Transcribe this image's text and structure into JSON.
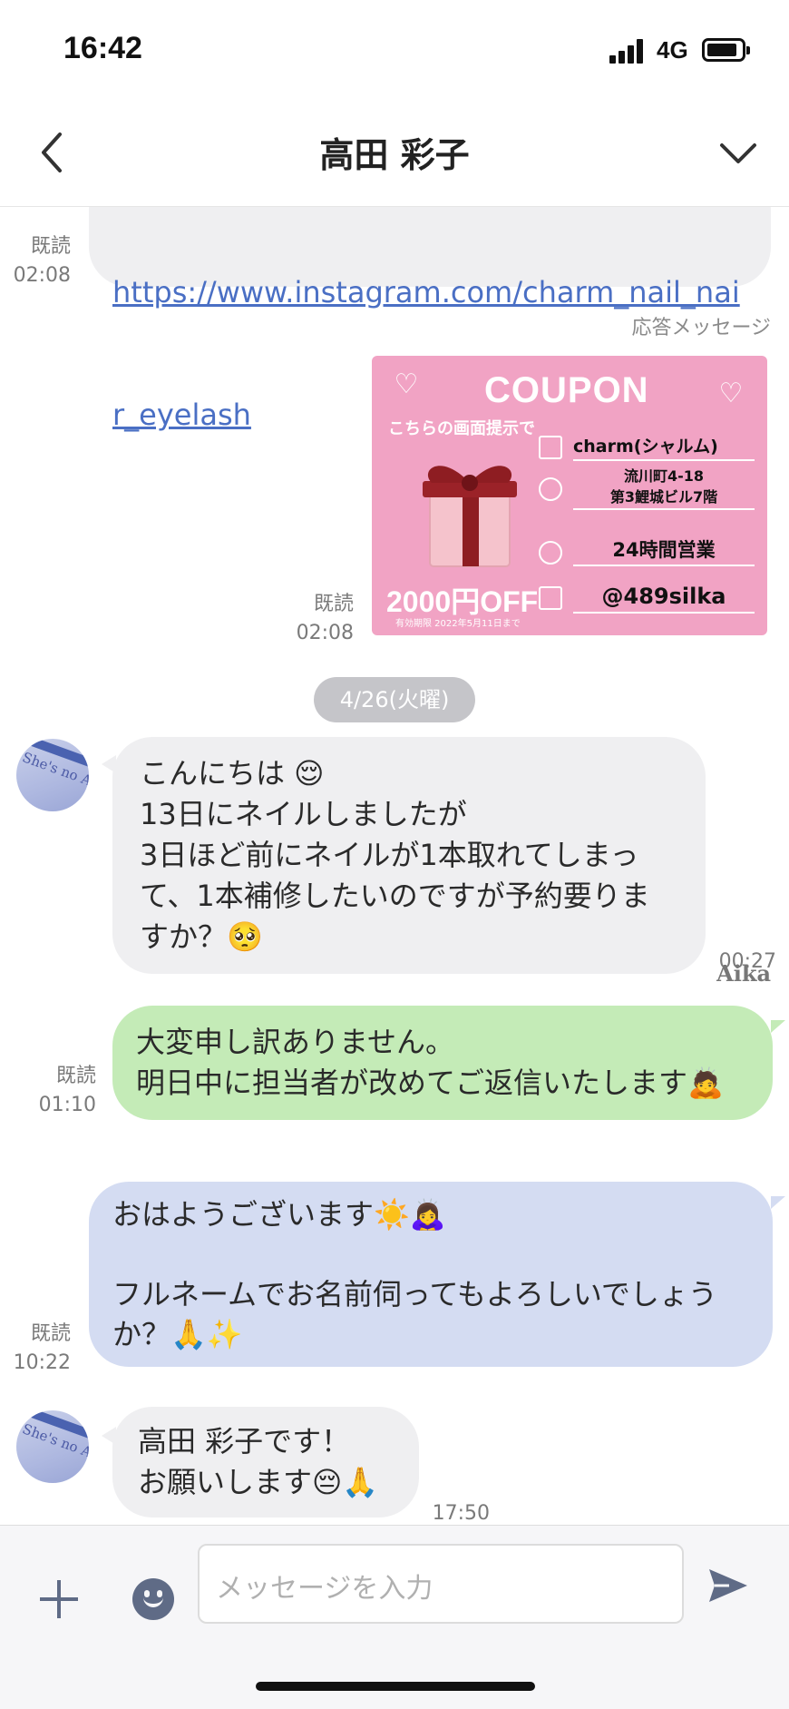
{
  "status_bar": {
    "time": "16:42",
    "network": "4G"
  },
  "header": {
    "title": "高田 彩子"
  },
  "messages": {
    "link_message": {
      "text_line1": "https://www.instagram.com/charm_nail_nai",
      "text_line2": "r_eyelash",
      "read": "既読",
      "time": "02:08"
    },
    "auto_reply_label": "応答メッセージ",
    "coupon_message": {
      "read": "既読",
      "time": "02:08",
      "coupon": {
        "title": "COUPON",
        "subtitle": "こちらの画面提示で",
        "discount": "2000円OFF",
        "valid": "有効期限 2022年5月11日まで",
        "shop": "charm(シャルム)",
        "address_line1": "流川町4-18",
        "address_line2": "第3鯉城ビル7階",
        "hours": "24時間営業",
        "line_id": "@489silka"
      }
    },
    "date_separator": "4/26(火曜)",
    "customer_msg1": {
      "text": "こんにちは 😌\n13日にネイルしましたが\n3日ほど前にネイルが1本取れてしまっ\nて、1本補修したいのですが予約要りま\nすか？🥺",
      "time": "00:27"
    },
    "reply_msg1": {
      "text": "大変申し訳ありません。\n明日中に担当者が改めてご返信いたします🙇",
      "read": "既読",
      "time": "01:10"
    },
    "sender_name": "Aika",
    "reply_msg2": {
      "text": "おはようございます☀️🙇‍♀️\n\nフルネームでお名前伺ってもよろしいでしょう\nか？🙏✨",
      "read": "既読",
      "time": "10:22"
    },
    "customer_msg2": {
      "text": "高田 彩子です！\nお願いします😔🙏",
      "time": "17:50"
    },
    "avatar_text": "She's no Angel"
  },
  "input": {
    "placeholder": "メッセージを入力"
  },
  "icons": [
    "back-icon",
    "chevron-down-icon",
    "plus-icon",
    "emoji-icon",
    "send-icon",
    "signal-icon",
    "battery-icon"
  ],
  "colors": {
    "green_bubble": "#c4ebb7",
    "blue_bubble": "#d4dcf2",
    "gray_bubble": "#efeff1",
    "link": "#4a6fc4"
  }
}
